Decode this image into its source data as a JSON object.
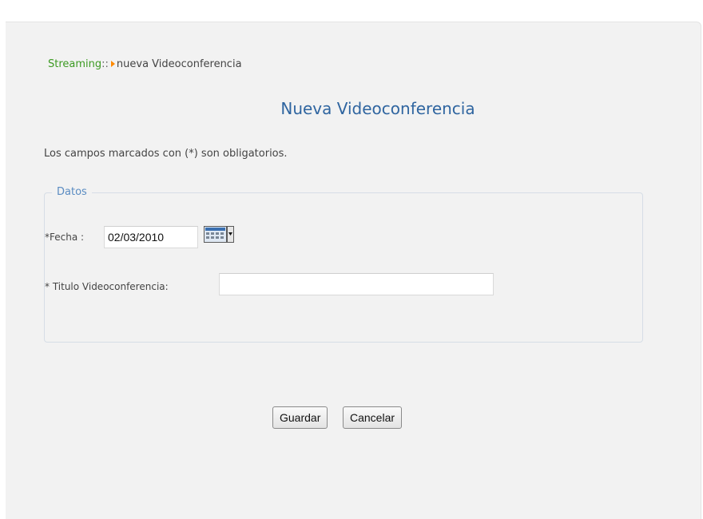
{
  "breadcrumb": {
    "root": "Streaming",
    "separator": "::",
    "current": "nueva Videoconferencia"
  },
  "page_title": "Nueva Videoconferencia",
  "required_note": "Los campos marcados con (*) son obligatorios.",
  "fieldset": {
    "legend": "Datos",
    "fecha": {
      "label": "*Fecha :",
      "value": "02/03/2010",
      "icon": "calendar-icon"
    },
    "titulo": {
      "label": "* Titulo Videoconferencia:",
      "value": ""
    }
  },
  "buttons": {
    "save": "Guardar",
    "cancel": "Cancelar"
  },
  "colors": {
    "breadcrumb_root": "#3c9a22",
    "title": "#2f65a0",
    "legend": "#5a8cc2",
    "arrow": "#ff8a00",
    "panel_bg": "#f2f2f2"
  }
}
